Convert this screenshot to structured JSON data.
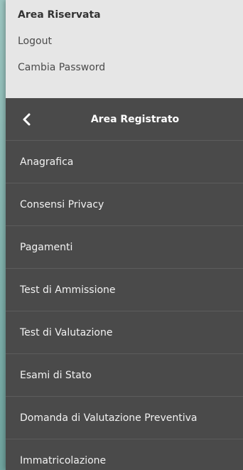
{
  "area_riservata": {
    "title": "Area Riservata",
    "logout_label": "Logout",
    "change_password_label": "Cambia Password"
  },
  "menu": {
    "back_icon": "chevron-left-icon",
    "title": "Area Registrato",
    "items": [
      {
        "label": "Anagrafica"
      },
      {
        "label": "Consensi Privacy"
      },
      {
        "label": "Pagamenti"
      },
      {
        "label": "Test di Ammissione"
      },
      {
        "label": "Test di Valutazione"
      },
      {
        "label": "Esami di Stato"
      },
      {
        "label": "Domanda di Valutazione Preventiva"
      },
      {
        "label": "Immatricolazione"
      }
    ]
  },
  "colors": {
    "top_background": "#e6e6e6",
    "menu_background": "#4a4a4a",
    "menu_text": "#f2f2f2",
    "backdrop": "#8fb9b4"
  }
}
